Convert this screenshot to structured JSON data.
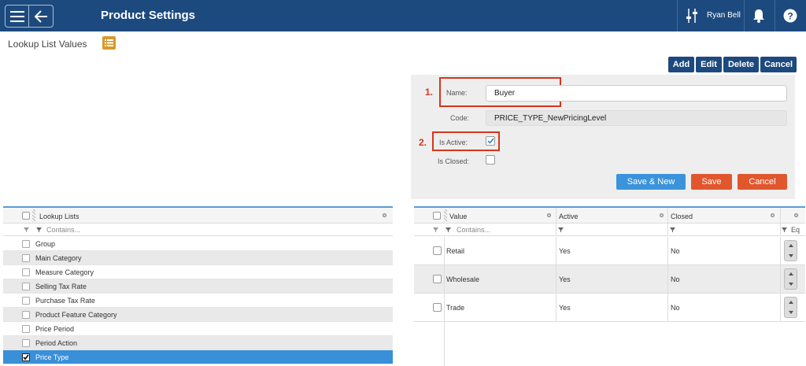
{
  "app": {
    "title": "Product Settings",
    "user_name": "Ryan Bell"
  },
  "page": {
    "title": "Lookup List Values"
  },
  "actions": [
    "Add",
    "Edit",
    "Delete",
    "Cancel"
  ],
  "form": {
    "name_label": "Name:",
    "name_value": "Buyer",
    "code_label": "Code:",
    "code_value": "PRICE_TYPE_NewPricingLevel",
    "is_active_label": "Is Active:",
    "is_active": true,
    "is_closed_label": "Is Closed:",
    "is_closed": false,
    "annotation_1": "1.",
    "annotation_2": "2.",
    "save_new": "Save & New",
    "save": "Save",
    "cancel": "Cancel"
  },
  "lookup_grid": {
    "header": "Lookup Lists",
    "filter_placeholder": "Contains...",
    "rows": [
      {
        "label": "Group",
        "checked": false
      },
      {
        "label": "Main Category",
        "checked": false
      },
      {
        "label": "Measure Category",
        "checked": false
      },
      {
        "label": "Selling Tax Rate",
        "checked": false
      },
      {
        "label": "Purchase Tax Rate",
        "checked": false
      },
      {
        "label": "Product Feature Category",
        "checked": false
      },
      {
        "label": "Price Period",
        "checked": false
      },
      {
        "label": "Period Action",
        "checked": false
      },
      {
        "label": "Price Type",
        "checked": true
      }
    ]
  },
  "values_grid": {
    "columns": {
      "value": "Value",
      "active": "Active",
      "closed": "Closed"
    },
    "filter_placeholder": "Contains...",
    "filter_extra": "Eq",
    "rows": [
      {
        "value": "Retail",
        "active": "Yes",
        "closed": "No"
      },
      {
        "value": "Wholesale",
        "active": "Yes",
        "closed": "No"
      },
      {
        "value": "Trade",
        "active": "Yes",
        "closed": "No"
      }
    ]
  },
  "colors": {
    "header_bg": "#1d4a7e",
    "accent_blue": "#3a8fd9",
    "danger": "#e0572e",
    "annotation_red": "#d8341b",
    "list_icon": "#d79a2c"
  }
}
